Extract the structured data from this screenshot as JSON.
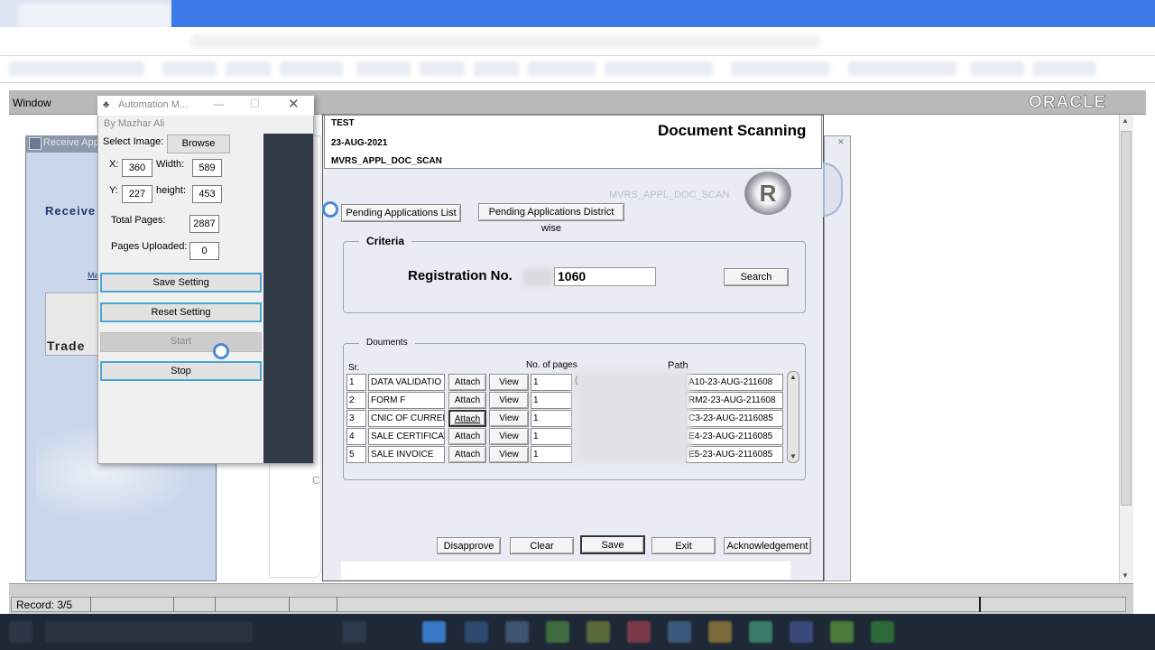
{
  "menu": {
    "window_label": "Window"
  },
  "brand": {
    "logo": "ORACLE"
  },
  "status": {
    "record": "Record: 3/5"
  },
  "receive_window": {
    "title": "Receive App",
    "heading": "Receive",
    "link": "Ma",
    "trade": "Trade",
    "side_label": "C"
  },
  "doc_form": {
    "env": "TEST",
    "date": "23-AUG-2021",
    "form_code": "MVRS_APPL_DOC_SCAN",
    "title": "Document Scanning",
    "watermark": "MVRS_APPL_DOC_SCAN",
    "logo_letter": "R",
    "pending_list_label": "Pending Applications List",
    "pending_district_label": "Pending Applications District wise",
    "criteria_label": "Criteria",
    "registration_label": "Registration No.",
    "registration_value": "1060",
    "search_label": "Search",
    "documents_label": "Douments",
    "col_sr": "Sr.",
    "col_pages": "No. of pages",
    "col_path": "Path",
    "rows": [
      {
        "sr": "1",
        "name": "DATA VALIDATIO",
        "attach": "Attach",
        "view": "View",
        "pages": "1",
        "path": "A10-23-AUG-211608"
      },
      {
        "sr": "2",
        "name": "FORM F",
        "attach": "Attach",
        "view": "View",
        "pages": "1",
        "path": "RM2-23-AUG-211608"
      },
      {
        "sr": "3",
        "name": "CNIC OF CURRENT",
        "attach": "Attach",
        "view": "View",
        "pages": "1",
        "path": "C3-23-AUG-2116085"
      },
      {
        "sr": "4",
        "name": "SALE CERTIFICAT",
        "attach": "Attach",
        "view": "View",
        "pages": "1",
        "path": "E4-23-AUG-2116085"
      },
      {
        "sr": "5",
        "name": "SALE INVOICE",
        "attach": "Attach",
        "view": "View",
        "pages": "1",
        "path": "E5-23-AUG-2116085"
      }
    ],
    "row_extra": "(",
    "disapprove_label": "Disapprove",
    "clear_label": "Clear",
    "save_label": "Save",
    "exit_label": "Exit",
    "ack_label": "Acknowledgement"
  },
  "automation": {
    "title": "Automation M...",
    "author": "By Mazhar Ali",
    "select_image_label": "Select Image:",
    "browse_label": "Browse",
    "x_label": "X:",
    "x_value": "360",
    "width_label": "Width:",
    "width_value": "589",
    "y_label": "Y:",
    "y_value": "227",
    "height_label": "height:",
    "height_value": "453",
    "total_pages_label": "Total Pages:",
    "total_pages_value": "2887",
    "pages_uploaded_label": "Pages Uploaded:",
    "pages_uploaded_value": "0",
    "save_setting_label": "Save Setting",
    "reset_setting_label": "Reset Setting",
    "start_label": "Start",
    "stop_label": "Stop"
  },
  "icons": [
    "automation-app-icon",
    "minimize-icon",
    "maximize-icon",
    "close-icon",
    "scroll-up-icon",
    "scroll-down-icon",
    "oracle-form-icon"
  ],
  "colors": {
    "browser_accent": "#3b7ae8",
    "form_bg": "#e9ecf4",
    "panel_dark": "#323b48",
    "button_border": "#4aa5d4",
    "taskbar": "#1e2836"
  }
}
